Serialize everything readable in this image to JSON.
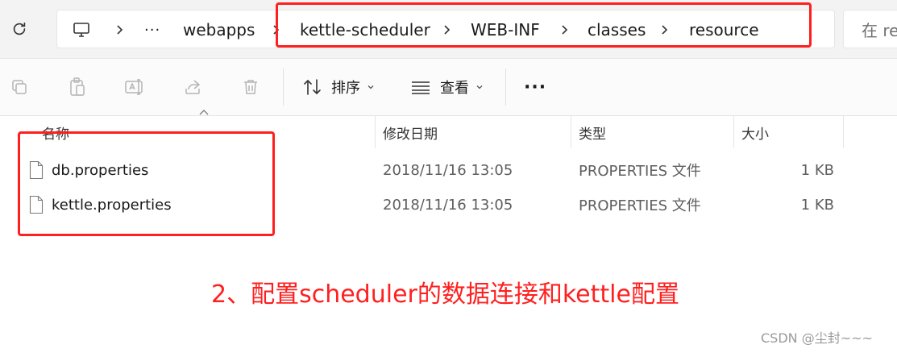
{
  "address_bar": {
    "breadcrumbs": [
      "webapps",
      "kettle-scheduler",
      "WEB-INF",
      "classes",
      "resource"
    ],
    "overflow_label": "···",
    "icons": [
      "refresh-icon",
      "computer-icon",
      "chevron-right-icon"
    ]
  },
  "search": {
    "placeholder": "在 re"
  },
  "command_bar": {
    "icons": [
      "copy-icon",
      "paste-icon",
      "rename-icon",
      "share-icon",
      "delete-icon"
    ],
    "sort_label": "排序",
    "view_label": "查看",
    "more_label": "···"
  },
  "columns": {
    "name": "名称",
    "modified": "修改日期",
    "type": "类型",
    "size": "大小"
  },
  "files": [
    {
      "name": "db.properties",
      "modified": "2018/11/16 13:05",
      "type": "PROPERTIES 文件",
      "size": "1 KB"
    },
    {
      "name": "kettle.properties",
      "modified": "2018/11/16 13:05",
      "type": "PROPERTIES 文件",
      "size": "1 KB"
    }
  ],
  "annotation": {
    "text": "2、配置scheduler的数据连接和kettle配置",
    "color": "#ff1f1f"
  },
  "watermark": "CSDN @尘封~~~"
}
